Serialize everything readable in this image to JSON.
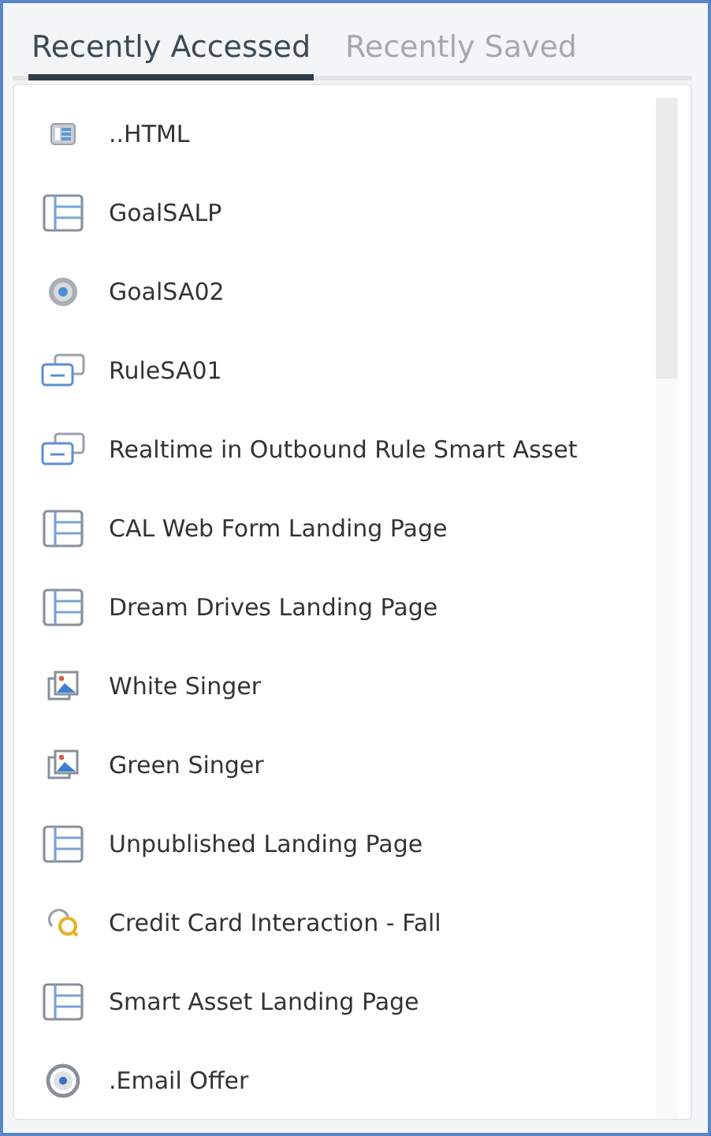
{
  "tabs": [
    {
      "label": "Recently Accessed",
      "selected": true
    },
    {
      "label": "Recently Saved",
      "selected": false
    }
  ],
  "items": [
    {
      "kind": "html",
      "label": "..HTML"
    },
    {
      "kind": "page",
      "label": "GoalSALP"
    },
    {
      "kind": "goal",
      "label": "GoalSA02"
    },
    {
      "kind": "rule",
      "label": "RuleSA01"
    },
    {
      "kind": "rule",
      "label": "Realtime in Outbound Rule Smart Asset"
    },
    {
      "kind": "page",
      "label": "CAL Web Form Landing Page"
    },
    {
      "kind": "page",
      "label": "Dream Drives Landing Page"
    },
    {
      "kind": "image",
      "label": "White Singer"
    },
    {
      "kind": "image",
      "label": "Green Singer"
    },
    {
      "kind": "page",
      "label": "Unpublished Landing Page"
    },
    {
      "kind": "interaction",
      "label": "Credit Card Interaction - Fall"
    },
    {
      "kind": "page",
      "label": "Smart Asset Landing Page"
    },
    {
      "kind": "offer",
      "label": ".Email Offer"
    }
  ]
}
